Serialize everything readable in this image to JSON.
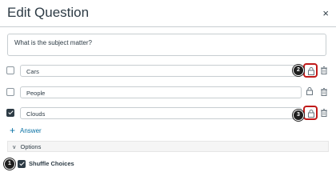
{
  "dialog": {
    "title": "Edit Question",
    "close_glyph": "×"
  },
  "question": {
    "text": "What is the subject matter?"
  },
  "answers": [
    {
      "text": "Cars",
      "checked": false
    },
    {
      "text": "People",
      "checked": false
    },
    {
      "text": "Clouds",
      "checked": true
    }
  ],
  "callouts": {
    "one": "1",
    "two": "2",
    "three": "3"
  },
  "add_answer": {
    "plus": "+",
    "label": "Answer"
  },
  "options": {
    "chevron": "v",
    "label": "Options"
  },
  "shuffle": {
    "label": "Shuffle Choices",
    "checked": true
  },
  "colors": {
    "highlight": "#c01a1a",
    "link": "#0770a3",
    "text": "#2d3b45"
  },
  "icons": {
    "lock": "lock-icon",
    "trash": "trash-icon",
    "close": "close-icon"
  }
}
